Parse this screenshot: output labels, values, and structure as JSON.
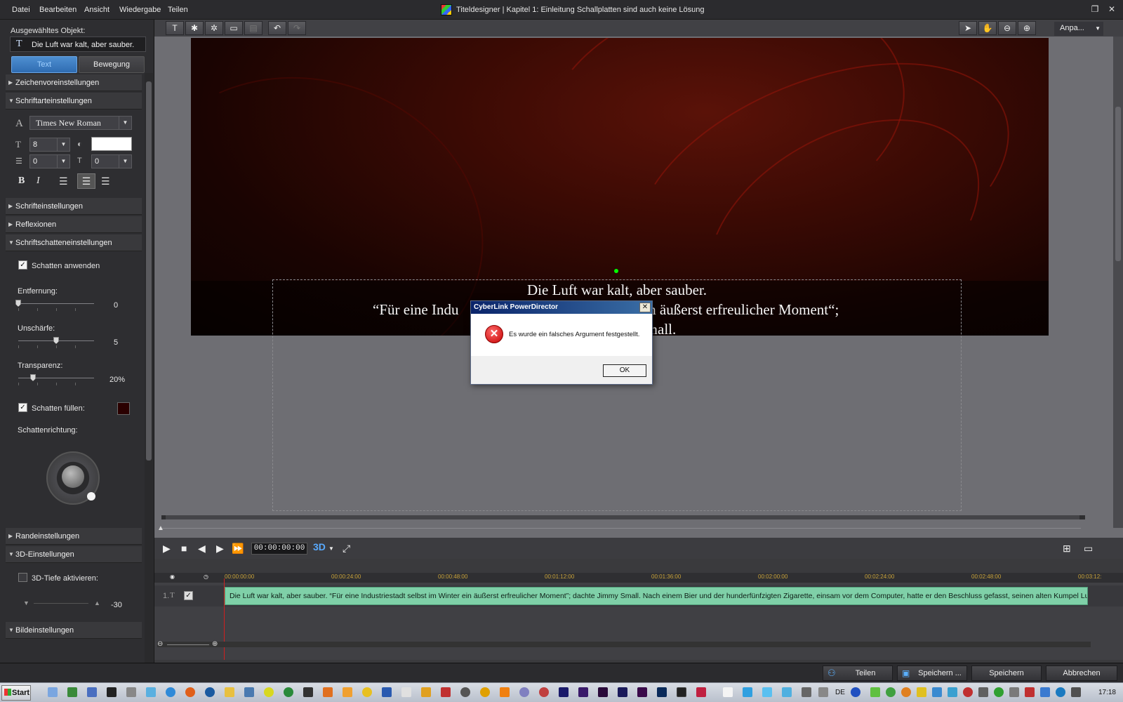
{
  "menu": [
    "Datei",
    "Bearbeiten",
    "Ansicht",
    "Wiedergabe",
    "Teilen"
  ],
  "window_title": "Titeldesigner  |  Kapitel 1: Einleitung Schallplatten sind auch keine Lösung",
  "left": {
    "selected_label": "Ausgewähltes Objekt:",
    "selected_value": "Die Luft war kalt, aber sauber.",
    "tab_text": "Text",
    "tab_move": "Bewegung",
    "sections": {
      "presets": "Zeichenvoreinstellungen",
      "font": "Schriftarteinstellungen",
      "fontsettings": "Schrifteinstellungen",
      "reflections": "Reflexionen",
      "shadow": "Schriftschatteneinstellungen",
      "border": "Randeinstellungen",
      "three_d": "3D-Einstellungen",
      "image": "Bildeinstellungen"
    },
    "font_name": "Times New Roman",
    "font_size": "8",
    "line_spacing": "0",
    "char_spacing": "0",
    "bold": "B",
    "italic": "I",
    "apply_shadow": "Schatten anwenden",
    "distance_label": "Entfernung:",
    "distance_value": "0",
    "blur_label": "Unschärfe:",
    "blur_value": "5",
    "transparency_label": "Transparenz:",
    "transparency_value": "20%",
    "fill_shadow": "Schatten füllen:",
    "shadow_dir": "Schattenrichtung:",
    "depth_label": "3D-Tiefe aktivieren:",
    "depth_value": "-30"
  },
  "toolbar": {
    "fit": "Anpa..."
  },
  "stage": {
    "line1": "Die Luft war kalt, aber sauber.",
    "line2a": "“Für eine Indu",
    "line2b": "ein äußerst erfreulicher Moment“;",
    "line3": "Small."
  },
  "playback": {
    "timecode": "00:00:00:00",
    "mode_3d": "3D"
  },
  "timeline": {
    "ruler": [
      "00:00:00:00",
      "00:00:24:00",
      "00:00:48:00",
      "00:01:12:00",
      "00:01:36:00",
      "00:02:00:00",
      "00:02:24:00",
      "00:02:48:00",
      "00:03:12:"
    ],
    "track_num": "1.",
    "clip_text": "Die Luft war kalt, aber sauber. “Für eine Industriestadt selbst im Winter ein äußerst erfreulicher Moment”; dachte Jimmy Small. Nach einem Bier und der hunderfünfzigten Zigarette, einsam vor dem Computer, hatte er den Beschluss gefasst, seinen alten Kumpel Luigi anzurufen und zu ih"
  },
  "actions": {
    "share": "Teilen",
    "save_as": "Speichern ...",
    "save": "Speichern",
    "cancel": "Abbrechen"
  },
  "dialog": {
    "title": "CyberLink PowerDirector",
    "message": "Es wurde ein falsches Argument festgestellt.",
    "ok": "OK"
  },
  "taskbar": {
    "start": "Start",
    "lang": "DE",
    "clock": "17:18"
  },
  "colors": {
    "accent": "#3a7fc8",
    "clip": "#7fd0a8",
    "shadow_fill": "#2a0000"
  }
}
